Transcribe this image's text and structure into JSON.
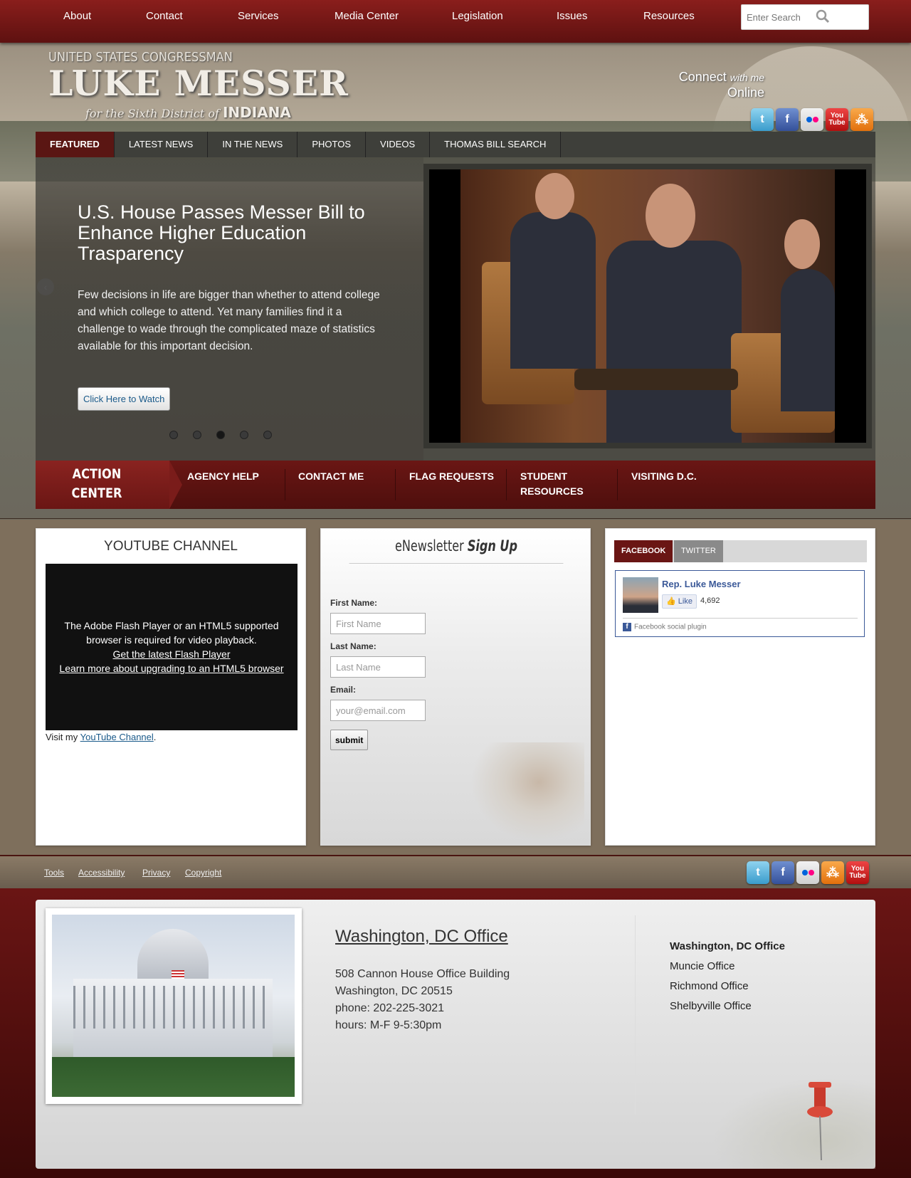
{
  "topnav": {
    "items": [
      "About",
      "Contact",
      "Services",
      "Media Center",
      "Legislation",
      "Issues",
      "Resources"
    ],
    "search_placeholder": "Enter Search"
  },
  "header": {
    "logo_line1": "UNITED STATES CONGRESSMAN",
    "logo_name": "LUKE MESSER",
    "logo_sub": "for the Sixth District of",
    "logo_state": "INDIANA",
    "connect": "Connect",
    "connect_with": "with me",
    "connect_online": "Online",
    "social_icons": [
      "twitter-icon",
      "facebook-icon",
      "flickr-icon",
      "youtube-icon",
      "rss-icon"
    ]
  },
  "tabs": [
    "FEATURED",
    "LATEST NEWS",
    "IN THE NEWS",
    "PHOTOS",
    "VIDEOS",
    "THOMAS BILL SEARCH"
  ],
  "slider": {
    "headline": "U.S. House Passes Messer Bill to Enhance Higher Education Trasparency",
    "blurb": "Few decisions in life are bigger than whether to attend college and which college to attend. Yet many families find it a challenge to wade through the complicated maze of statistics available for this important decision.",
    "button": "Click Here to Watch",
    "slide_count": 5,
    "active_slide": 3
  },
  "action_center": {
    "title_line1": "ACTION",
    "title_line2": "CENTER",
    "links": [
      "AGENCY HELP",
      "CONTACT ME",
      "FLAG REQUESTS",
      "STUDENT RESOURCES",
      "VISITING D.C."
    ]
  },
  "youtube": {
    "title": "YOUTUBE CHANNEL",
    "player_msg": "The Adobe Flash Player or an HTML5 supported browser is required for video playback.",
    "link1": "Get the latest Flash Player",
    "link2": "Learn more about upgrading to an HTML5 browser",
    "visit_prefix": "Visit my",
    "visit_link": "YouTube Channel",
    "visit_suffix": "."
  },
  "newsletter": {
    "title_a": "eNewsletter",
    "title_b": "Sign Up",
    "first_label": "First Name:",
    "first_placeholder": "First Name",
    "last_label": "Last Name:",
    "last_placeholder": "Last Name",
    "email_label": "Email:",
    "email_placeholder": "your@email.com",
    "submit": "submit"
  },
  "social_widget": {
    "tab_active": "FACEBOOK",
    "tab_other": "TWITTER",
    "page_name": "Rep. Luke Messer",
    "like": "Like",
    "like_count": "4,692",
    "plugin_label": "Facebook social plugin"
  },
  "footer_links": [
    "Tools",
    "Accessibility",
    "Privacy",
    "Copyright"
  ],
  "office": {
    "heading": "Washington, DC Office",
    "address1": "508 Cannon House Office Building",
    "address2": "Washington, DC 20515",
    "phone": "phone: 202-225-3021",
    "hours": "hours: M-F 9-5:30pm",
    "list": [
      "Washington, DC Office",
      "Muncie Office",
      "Richmond Office",
      "Shelbyville Office"
    ]
  },
  "colors": {
    "brand_red": "#6a1614",
    "facebook_blue": "#3b5998",
    "link_blue": "#1a5a8a"
  }
}
